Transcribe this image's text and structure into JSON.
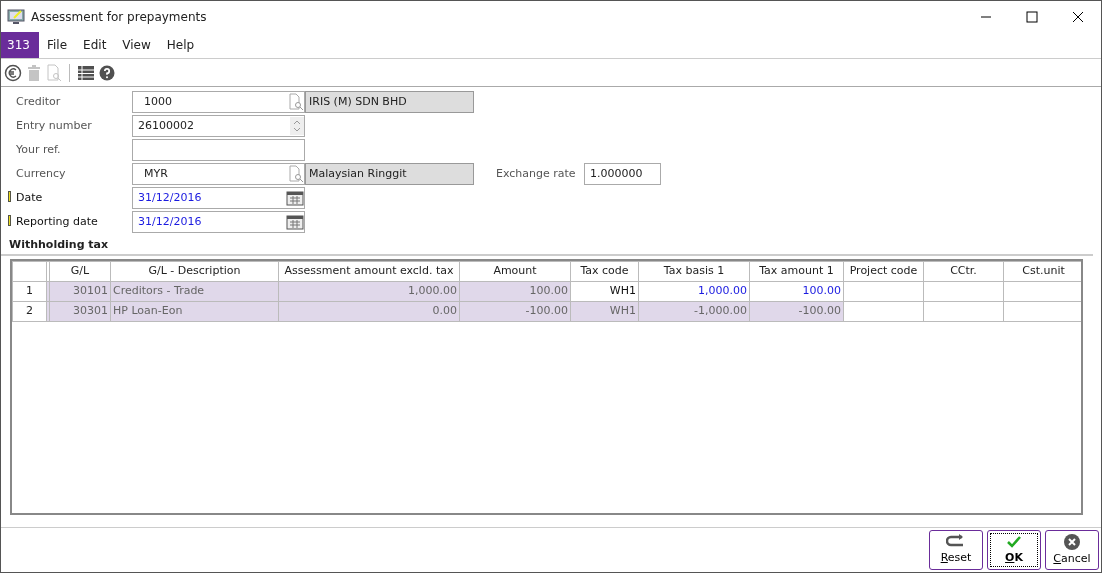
{
  "window": {
    "title": "Assessment for prepayments"
  },
  "menu": {
    "badge": "313",
    "items": [
      "File",
      "Edit",
      "View",
      "Help"
    ]
  },
  "toolbar": [
    {
      "kind": "euro",
      "disabled": false
    },
    {
      "kind": "trash",
      "disabled": true
    },
    {
      "kind": "preview",
      "disabled": true
    },
    {
      "kind": "sep"
    },
    {
      "kind": "list",
      "disabled": false
    },
    {
      "kind": "help",
      "disabled": false
    }
  ],
  "form": [
    {
      "label": "Creditor",
      "kind": "lookup",
      "value": "1000",
      "description": "IRIS (M) SDN BHD",
      "required": false
    },
    {
      "label": "Entry number",
      "kind": "spinner",
      "value": "26100002",
      "required": false
    },
    {
      "label": "Your ref.",
      "kind": "text",
      "required": false
    },
    {
      "label": "Currency",
      "kind": "lookup",
      "value": "MYR",
      "description": "Malaysian Ringgit",
      "required": false,
      "extra": {
        "label": "Exchange rate",
        "value": "1.000000"
      }
    },
    {
      "label": "Date",
      "kind": "date",
      "value": "31/12/2016",
      "required": true
    },
    {
      "label": "Reporting date",
      "kind": "date",
      "value": "31/12/2016",
      "required": true
    }
  ],
  "section": "Withholding tax",
  "table": {
    "columns": [
      "G/L",
      "G/L - Description",
      "Assessment amount excld. tax",
      "Amount",
      "Tax code",
      "Tax basis 1",
      "Tax amount 1",
      "Project code",
      "CCtr.",
      "Cst.unit"
    ],
    "rows": [
      {
        "number": "1",
        "cells": [
          "30101",
          "Creditors - Trade",
          "1,000.00",
          "100.00",
          "WH1",
          "1,000.00",
          "100.00"
        ],
        "editable": true
      },
      {
        "number": "2",
        "cells": [
          "30301",
          "HP Loan-Eon",
          "0.00",
          "-100.00",
          "WH1",
          "-1,000.00",
          "-100.00"
        ],
        "editable": false
      }
    ]
  },
  "buttons": [
    {
      "kind": "reset",
      "label": "Reset",
      "default": false
    },
    {
      "kind": "ok",
      "label": "OK",
      "default": true
    },
    {
      "kind": "cancel",
      "label": "Cancel",
      "default": false
    }
  ]
}
